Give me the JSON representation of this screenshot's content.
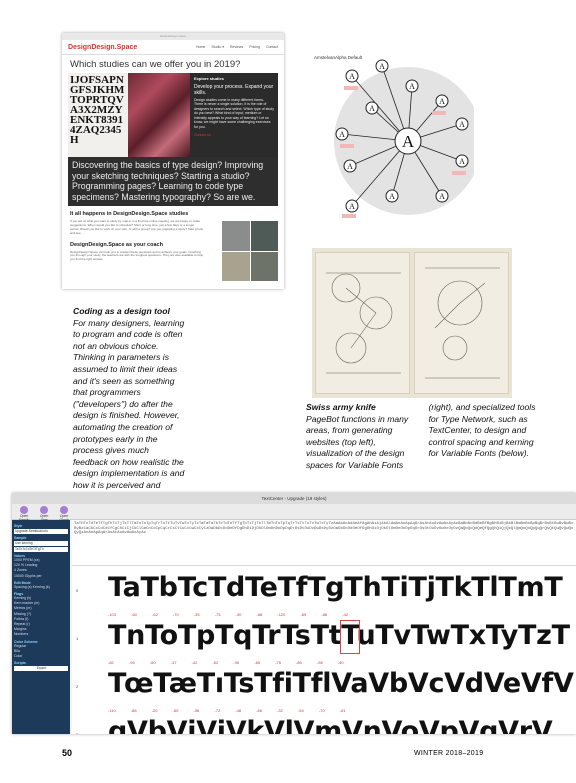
{
  "website": {
    "url": "designdesign.space",
    "logo": "DesignDesign.Space",
    "menu": [
      "Home",
      "Studio ▾",
      "Reviews",
      "Pricing",
      "Contact"
    ],
    "heading": "Which studies can we offer you in 2019?",
    "letters": "IJOFSAPNGFSJKHMTOPRTQVA3X2MZYENKT83914ZAQ2345H",
    "side_title": "Explore studies",
    "side_sub": "Develop your process. Expand your skills.",
    "side_text": "Design studies come in many different forms. There is never a single solution. It is the role of designers to search and select. Which type of study do you best? What kind of input, medium or intensity appeals to your way of learning? Let us know, we might have some challenging exercises for you.",
    "side_link": "Contact us",
    "dark": "Discovering the basics of type design? Improving your sketching techniques? Starting a studio? Programming pages? Learning to code type specimens? Mastering typography? So are we.",
    "sub1": "It all happens in DesignDesign.Space studies",
    "p1": "If you tell us what you want to study by mail or in a first free online meeting, we are happy to make suggestions. When would you like to schedule? Short or long time, just a few days or a longer period. Would you like to work on your own, or with a group? Are you preparing a study? Take a look and see.",
    "sub2": "DesignDesign.Space as your coach",
    "p2": "DesignDesign.Space can help you to answer these questions and to achieve your goals. Coaching you through your study, the teachers are with the toughest questions. They are also available to help you find the right answer."
  },
  "diagram": {
    "title": "AmstelvanAlpha Default",
    "center": "A",
    "nodes": [
      "A",
      "A",
      "A",
      "A",
      "A",
      "A",
      "A",
      "A",
      "A",
      "A",
      "A",
      "A",
      "A"
    ]
  },
  "caption1": {
    "title": "Coding as a design tool",
    "body": "For many designers, learning to program and code is often not an obvious choice. Thinking in parameters is assumed to limit their ideas and it's seen as something that programmers (\"developers\") do after the design is finished. However, automating the creation of prototypes early in the process gives much feedback on how realistic the design implementation is and how it is perceived and interpreted by users. DesignDesign.Space offers studies on a Master's level, to let designers study their own process: Type, Tool and Teaching, in any combination, length or intensity. Recursion in action: A designer can design only if process and tools are considered too."
  },
  "caption2": {
    "title": "Swiss army knife",
    "body": "PageBot functions in many areas, from generating websites (top left), visualization of the design spaces for Variable Fonts (right), and specialized tools for Type Network, such as TextCenter, to design and control spacing and kerning for Variable Fonts (below)."
  },
  "textcenter": {
    "title": "TextCenter - Upgrade (18 styles)",
    "tools": [
      "Open Family",
      "Open Size",
      "Open Glyph"
    ],
    "side": {
      "style": "Style",
      "style_val": "Upgrade-Semibold.ufo",
      "sample": "Sample",
      "sample_val": "Use kerning",
      "glyphs": "TaTbTcTdTeTfTgTh",
      "values": "Values",
      "v1": "1000",
      "v1l": "PPEM (xx)",
      "v2": "120",
      "v2l": "% Leading",
      "v3": "4",
      "v3l": "Zones",
      "v4": "10000",
      "v4l": "Glyphs per",
      "edit": "Edit Mode",
      "edit_opts": "Spacing (s)  Kerning (k)",
      "flags": "Flags",
      "flag_items": [
        "Kerning (k)",
        "Kern marker (m)",
        "Metrics (m)",
        "Missing (?)",
        "Follow (f)",
        "Repeat (r)",
        "Margins",
        "Numbers"
      ],
      "scheme": "Color Scheme",
      "scheme_items": [
        "Regular",
        "Bila",
        "Color"
      ],
      "scripts": "Scripts",
      "export": "Export"
    },
    "strip": "TaTbTcTdTeTfTgThTiTjTkTlTmTnToTpTqTrTsTtTuTvTwTxTyTzTæTœTaTbTcTdTeTfTgThTiTjTkTlTmTnToTpTqTrTsTtTuTvTwTxTyTzAaAbAcAdAeAfAgAhAiAjAkAlAmAnAoApAqArAsAtAuAvAwAxAyAzBaBbBcBdBeBfBgBhBiBjBkBlBmBnBoBpBqBrBsBtBuBvBwBxByBzCaCbCcCdCeCfCgChCiCjCkClCmCnCoCpCqCrCsCtCuCvCwCxCyCzDaDbDcDdDeDfDgDhDiDjDkDlDmDnDoDpDqDrDsDtDuDvDwDxDyDzOaObOcOdOeOfOgOhOiOjOkOlOmOnOoOpOqOrOsOtOuOvOwOxOyOzQaQbQcQdQeQfQgQhQiQjQkQlQmQnQoQpQqQrQsQtQuQvQwQxQyQzAnAoApAqArAsAtAuAvAwAxAyAz",
    "rows": [
      {
        "n": "0",
        "g": "TaTbTcTdTeTfTgThTiTjTkTlTmT",
        "k": "-103 -60 -62 -70 -35 -75 -30 -68 -120 -69 -88 -42"
      },
      {
        "n": "1",
        "g": "TnToTpTqTrTsTtTuTvTwTxTyTzT",
        "k": "-82 -95 -60 -37 -42 -52 -90 -65 -75 -80 -98 -40"
      },
      {
        "n": "2",
        "g": "TœTæTıTsTfiTflVaVbVcVdVeVfV",
        "k": "-110 -88 -20 -60 -56 -72 -48 -66 -32 -54 -70 -61"
      },
      {
        "n": "3",
        "g": "gVbVjVjVkVlVmVnVoVpVqVrV",
        "k": ""
      }
    ]
  },
  "footer": {
    "page": "50",
    "issue": "WINTER 2018–2019"
  }
}
